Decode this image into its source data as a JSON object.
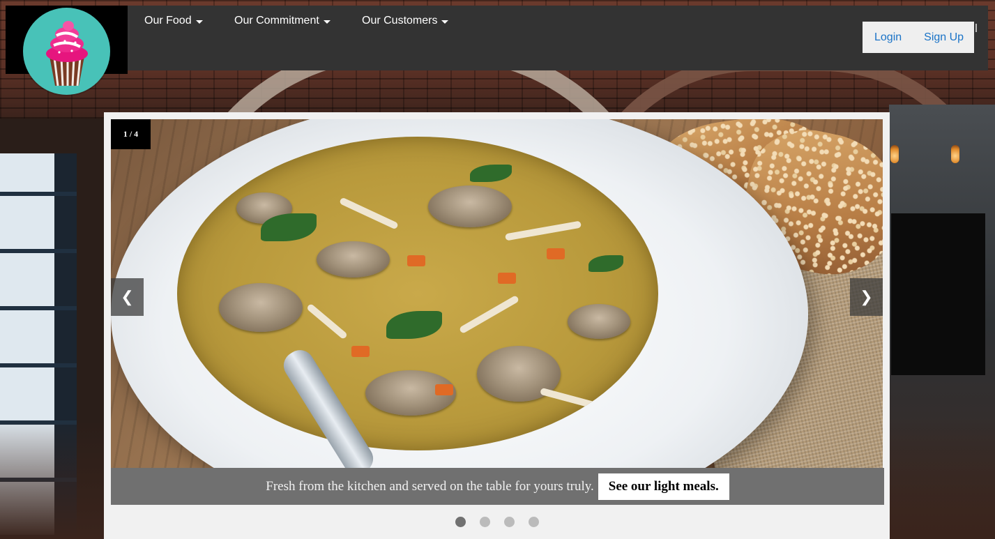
{
  "logo": {
    "icon": "cupcake-icon"
  },
  "nav": {
    "items": [
      {
        "label": "Our Food"
      },
      {
        "label": "Our Commitment"
      },
      {
        "label": "Our Customers"
      }
    ],
    "login": "Login",
    "signup": "Sign Up"
  },
  "slideshow": {
    "counter": "1 / 4",
    "prev_glyph": "❮",
    "next_glyph": "❯",
    "caption": "Fresh from the kitchen and served on the table for yours truly.",
    "cta": "See our light meals.",
    "total_slides": 4,
    "active_slide": 1
  },
  "colors": {
    "navbar": "#333333",
    "logo_circle": "#48c2b8",
    "link": "#1a73c7",
    "caption_bar": "#707070",
    "dot_active": "#717171",
    "dot_inactive": "#bbbbbb"
  }
}
